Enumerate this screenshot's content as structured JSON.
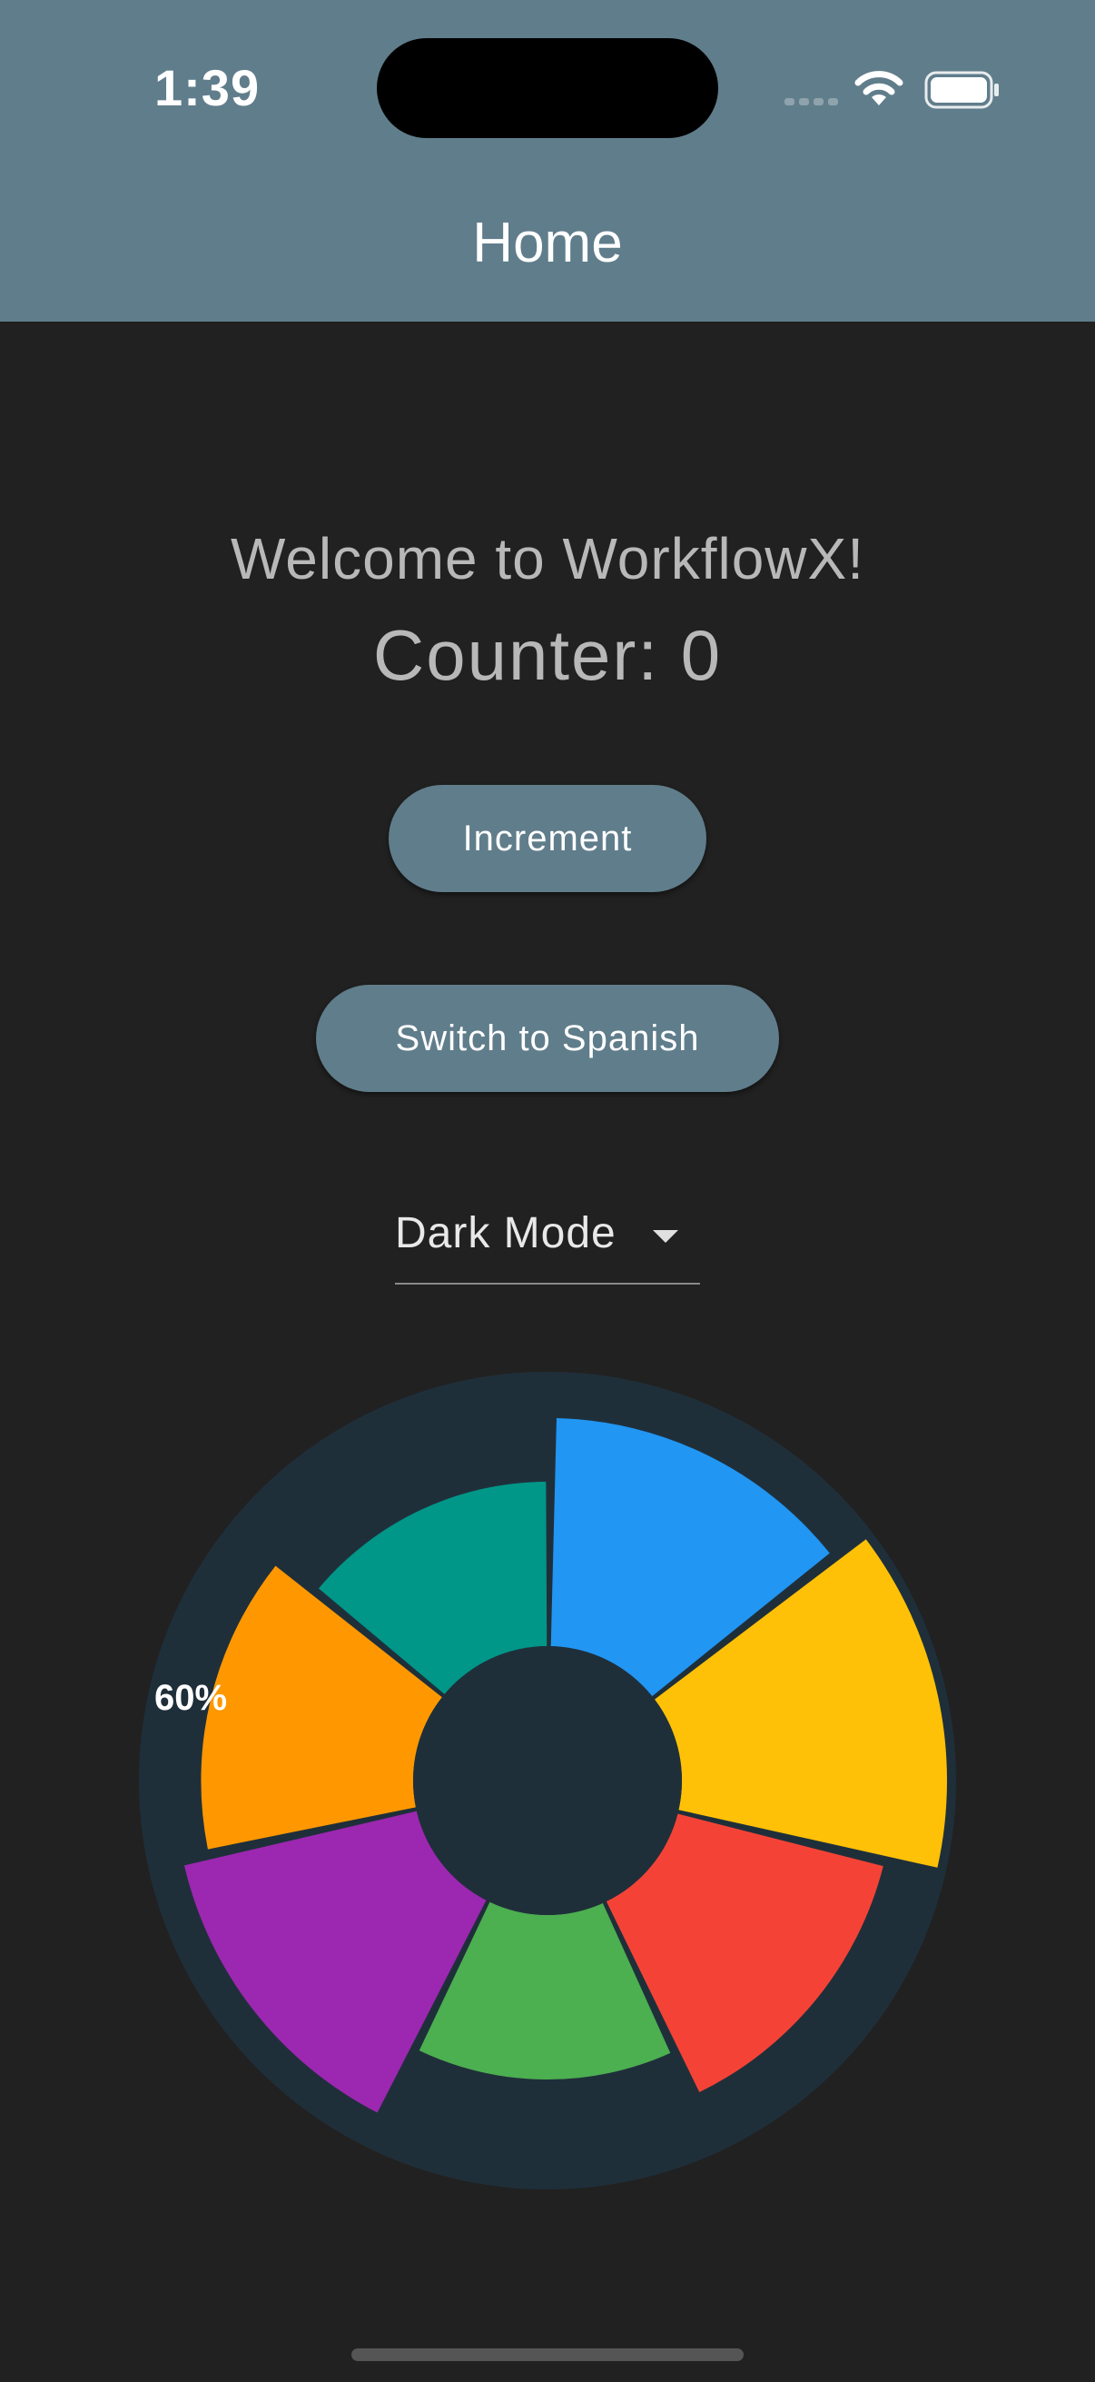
{
  "status_bar": {
    "time": "1:39",
    "icons": [
      "signal-icon",
      "wifi-icon",
      "battery-icon"
    ]
  },
  "app_bar": {
    "title": "Home",
    "color": "#607d8b"
  },
  "main": {
    "welcome_text": "Welcome to WorkflowX!",
    "counter_text": "Counter: 0",
    "increment_label": "Increment",
    "language_label": "Switch to Spanish",
    "theme_dropdown": {
      "selected": "Dark Mode"
    }
  },
  "chart_data": {
    "type": "pie",
    "variant": "polar-area",
    "hole": true,
    "background_color": "#1f2f3a",
    "label_visible": "60%",
    "slices": [
      {
        "color": "#2196f3",
        "relative_radius": 0.86
      },
      {
        "color": "#ffc107",
        "relative_radius": 1.0
      },
      {
        "color": "#f44336",
        "relative_radius": 0.8
      },
      {
        "color": "#4caf50",
        "relative_radius": 0.62
      },
      {
        "color": "#9c27b0",
        "relative_radius": 0.9
      },
      {
        "color": "#ff9800",
        "relative_radius": 0.8
      },
      {
        "color": "#009688",
        "relative_radius": 0.62
      }
    ]
  }
}
